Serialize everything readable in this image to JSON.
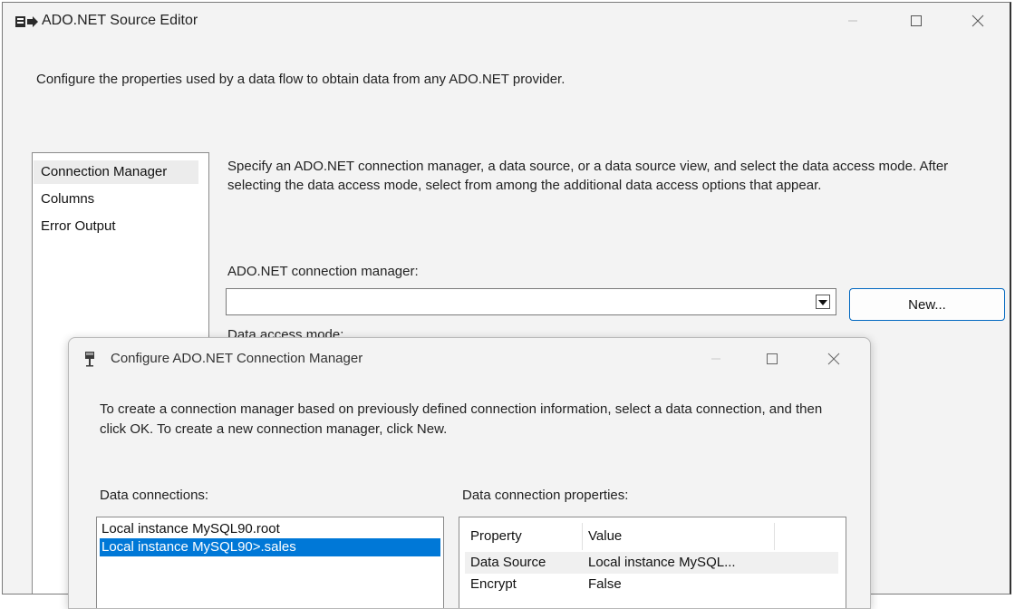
{
  "window": {
    "title": "ADO.NET Source Editor",
    "description": "Configure the properties used by a data flow to obtain data from any ADO.NET provider.",
    "nav_items": [
      "Connection Manager",
      "Columns",
      "Error Output"
    ],
    "right_description": "Specify an ADO.NET connection manager, a data source, or a data source view, and select the data access mode. After selecting the data access mode, select from among the additional data access options that appear.",
    "connection_manager_label": "ADO.NET connection manager:",
    "connection_manager_value": "",
    "new_button": "New...",
    "partial_label": "Data access mode:"
  },
  "dialog": {
    "title": "Configure ADO.NET Connection Manager",
    "description": "To create a connection manager based on previously defined connection information, select a data connection, and then click OK. To create a new connection manager, click New.",
    "data_connections_label": "Data connections:",
    "data_connection_properties_label": "Data connection properties:",
    "connections": [
      "Local instance MySQL90.root",
      "Local instance MySQL90>.sales"
    ],
    "selected_connection_index": 1,
    "properties_header": {
      "property": "Property",
      "value": "Value"
    },
    "properties": [
      {
        "property": "Data Source",
        "value": "Local instance MySQL..."
      },
      {
        "property": "Encrypt",
        "value": "False"
      }
    ]
  },
  "colors": {
    "accent": "#0078d7",
    "button_border": "#0067c0"
  },
  "icons": {
    "window": "ado-source-icon",
    "dialog": "connection-plug-icon"
  }
}
